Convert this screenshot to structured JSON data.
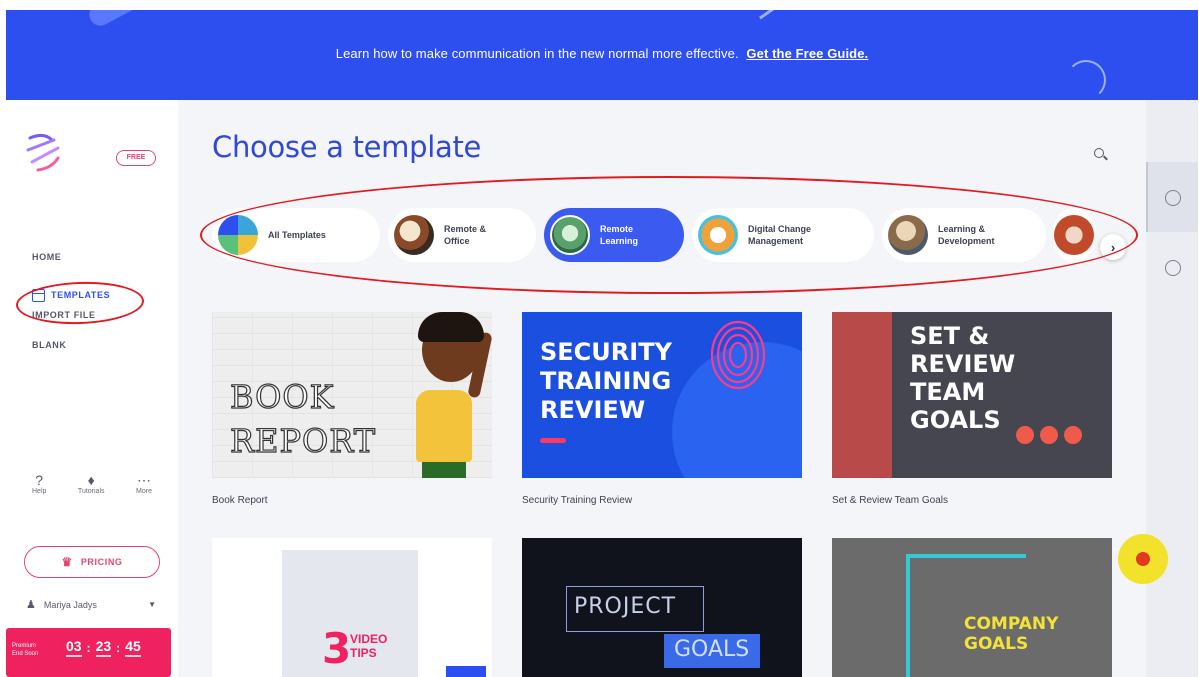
{
  "banner": {
    "text": "Learn how to make communication in the new normal more effective.",
    "link": "Get the Free Guide."
  },
  "sidebar": {
    "plan_badge": "FREE",
    "nav": [
      {
        "label": "HOME"
      },
      {
        "label": "TEMPLATES",
        "active": true
      },
      {
        "label": "IMPORT FILE"
      },
      {
        "label": "BLANK"
      }
    ],
    "tools": [
      {
        "icon": "help-icon",
        "glyph": "?",
        "label": "Help"
      },
      {
        "icon": "tutorials-icon",
        "glyph": "♦",
        "label": "Tutorials"
      },
      {
        "icon": "more-icon",
        "glyph": "⋯",
        "label": "More"
      }
    ],
    "pricing_label": "PRICING",
    "user_name": "Mariya Jadys",
    "promo_label": "Premium\nEnd Soon",
    "timer": {
      "h": "03",
      "m": "23",
      "s": "45"
    }
  },
  "main": {
    "title": "Choose a template",
    "categories": [
      {
        "label": "All Templates"
      },
      {
        "label": "Remote & Office"
      },
      {
        "label": "Remote Learning",
        "active": true
      },
      {
        "label": "Digital Change Management"
      },
      {
        "label": "Learning & Development"
      }
    ],
    "cards": [
      {
        "caption": "Book Report",
        "art": [
          "BOOK",
          "REPORT"
        ]
      },
      {
        "caption": "Security Training Review",
        "art": [
          "SECURITY",
          "TRAINING",
          "REVIEW"
        ]
      },
      {
        "caption": "Set & Review Team Goals",
        "art": [
          "SET &",
          "REVIEW",
          "TEAM",
          "GOALS"
        ]
      },
      {
        "caption": "",
        "art": [
          "3",
          "VIDEO",
          "TIPS"
        ]
      },
      {
        "caption": "",
        "art": [
          "PROJECT",
          "GOALS"
        ]
      },
      {
        "caption": "",
        "art": [
          "COMPANY",
          "GOALS"
        ]
      }
    ]
  },
  "colors": {
    "brand_blue": "#2d4ff0",
    "accent_pink": "#f0215f",
    "annotation_red": "#e01b22"
  }
}
